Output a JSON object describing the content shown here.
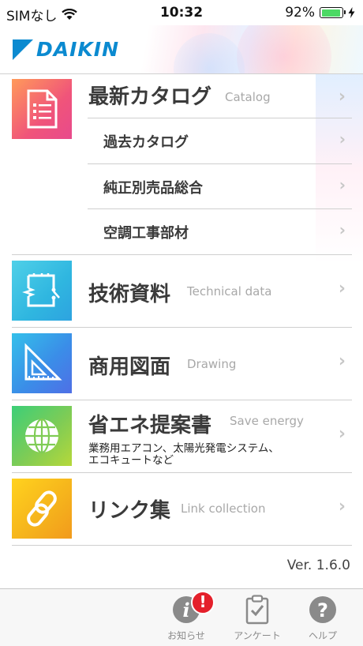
{
  "status": {
    "carrier": "SIMなし",
    "time": "10:32",
    "battery_percent_label": "92%",
    "battery_level": 0.92
  },
  "header": {
    "logo_text": "DAIKIN"
  },
  "menu": {
    "catalog": {
      "title": "最新カタログ",
      "subtitle": "Catalog",
      "sub_items": [
        "過去カタログ",
        "純正別売品総合",
        "空調工事部材"
      ]
    },
    "technical": {
      "title": "技術資料",
      "subtitle": "Technical data"
    },
    "drawing": {
      "title": "商用図面",
      "subtitle": "Drawing"
    },
    "energy": {
      "title": "省エネ提案書",
      "subtitle": "Save energy",
      "description_line1": "業務用エアコン、太陽光発電システム、",
      "description_line2": "エコキュートなど"
    },
    "links": {
      "title": "リンク集",
      "subtitle": "Link collection"
    }
  },
  "version": "Ver. 1.6.0",
  "tabs": [
    {
      "label": "お知らせ",
      "icon": "info-icon",
      "badge": "!"
    },
    {
      "label": "アンケート",
      "icon": "clipboard-icon"
    },
    {
      "label": "ヘルプ",
      "icon": "help-icon"
    }
  ],
  "colors": {
    "brand_blue": "#0b8ad0",
    "catalog_icon": "#f0547a",
    "technical_icon": "#2fb6e0",
    "drawing_icon": "#3a8ee8",
    "energy_icon": "#7fcc55",
    "links_icon": "#f5b21c",
    "badge_red": "#e4202b"
  }
}
